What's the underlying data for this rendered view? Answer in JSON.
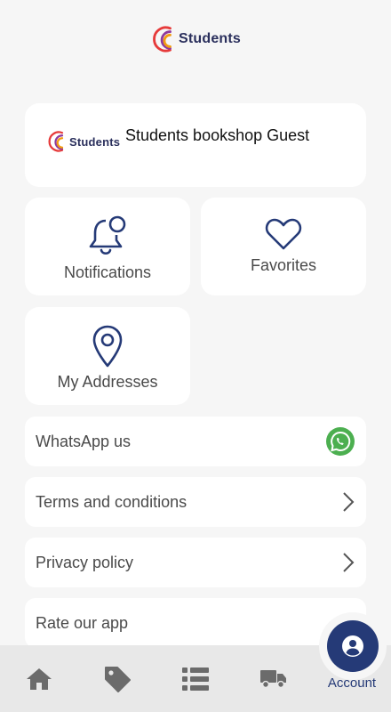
{
  "header": {
    "brand": "Students"
  },
  "profile": {
    "brand": "Students",
    "name": "Students bookshop Guest"
  },
  "tiles": {
    "notifications": {
      "label": "Notifications",
      "icon": "bell-icon"
    },
    "favorites": {
      "label": "Favorites",
      "icon": "heart-icon"
    },
    "addresses": {
      "label": "My Addresses",
      "icon": "location-pin-icon"
    }
  },
  "rows": {
    "whatsapp": {
      "label": "WhatsApp us",
      "icon": "whatsapp-icon"
    },
    "terms": {
      "label": "Terms and conditions",
      "icon": "chevron-right-icon"
    },
    "privacy": {
      "label": "Privacy policy",
      "icon": "chevron-right-icon"
    },
    "rate": {
      "label": "Rate our app"
    }
  },
  "nav": {
    "home": {
      "icon": "home-icon"
    },
    "offers": {
      "icon": "tag-icon"
    },
    "orders": {
      "icon": "list-icon"
    },
    "delivery": {
      "icon": "truck-icon"
    },
    "account": {
      "icon": "user-icon",
      "label": "Account"
    }
  },
  "colors": {
    "accent": "#253a77",
    "whatsapp": "#4caf50",
    "background": "#f6f6f6",
    "nav_background": "#e8e8e8"
  }
}
